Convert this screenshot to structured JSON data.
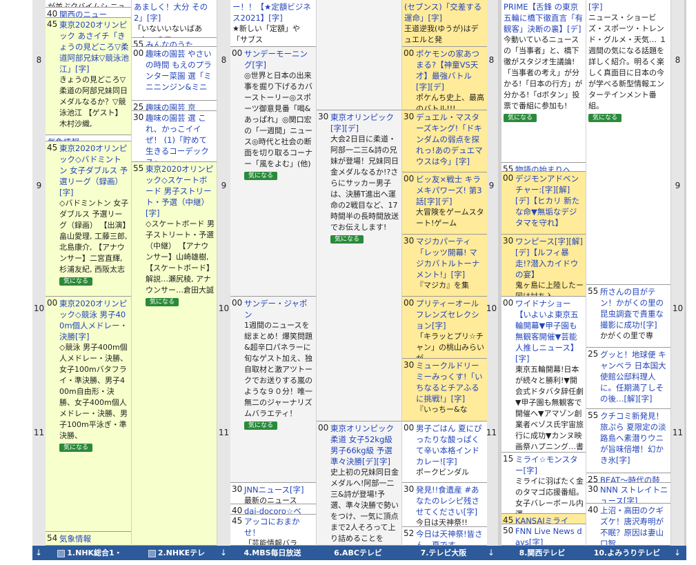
{
  "hours": [
    "8",
    "9",
    "10",
    "11"
  ],
  "badge_label": "気になる",
  "footer": {
    "arrow": "↓",
    "channels": [
      "1.NHK総合1・",
      "2.NHKEテレ",
      "4.MBS毎日放送",
      "6.ABCテレビ",
      "7.テレビ大阪",
      "8.関西テレビ",
      "10.よみうりテレビ"
    ]
  },
  "columns": [
    {
      "channel": "1.NHK総合1・",
      "cells": [
        {
          "min": "",
          "title": "",
          "desc": "が並ぶクバイムシ ニュースは…",
          "color": "white",
          "badge": false
        },
        {
          "min": "40",
          "title": "関西のニュー",
          "desc": "",
          "color": "white",
          "badge": false
        },
        {
          "min": "45",
          "title": "東京2020オリンピック あさイチ「きょうの見どころ▽柔道阿部兄妹▽競泳池江」[字]",
          "desc": "きょうの見どころ▽柔道の阿部兄妹同日メダルなるか？▽競泳池江 【ゲスト】木村沙織,",
          "color": "green",
          "badge": false
        },
        {
          "min": "",
          "title": "気象情報",
          "desc": "",
          "color": "white",
          "badge": false
        },
        {
          "min": "45",
          "title": "東京2020オリンピック◇バドミントン 女子ダブルス 予選リーグ（録画）[字]",
          "desc": "◇バドミントン 女子ダブルス 予選リーグ（録画） 【出演】畠山愛理, 工藤三郎, 北島康介, 【アナウンサー】二宮直輝, 杉浦友紀, 西阪太志",
          "color": "green",
          "badge": true
        },
        {
          "min": "00",
          "title": "東京2020オリンピック◇競泳 男子400m個人メドレー・決勝[字]",
          "desc": "◇競泳 男子400m個人メドレー・決勝、女子100mバタフライ・準決勝、男子400m自由形・決勝、女子400m個人メドレー・決勝、男子100m平泳ぎ・準決勝、",
          "color": "green",
          "badge": true
        },
        {
          "min": "54",
          "title": "気象情報",
          "desc": "",
          "color": "green",
          "badge": false
        }
      ]
    },
    {
      "channel": "2.NHKEテレ",
      "cells": [
        {
          "min": "",
          "title": "あましく！大分 その2」[字]",
          "desc": "「いないいないばあっ！」のワ",
          "color": "white",
          "badge": false
        },
        {
          "min": "55",
          "title": "みんなのうた",
          "desc": "",
          "color": "white",
          "badge": false
        },
        {
          "min": "00",
          "title": "趣味の園芸 やさいの時間 もえのプランター菜園 選「ミニニンジン&ミニ",
          "desc": "",
          "color": "white",
          "badge": false
        },
        {
          "min": "25",
          "title": "趣味の園芸 京",
          "desc": "",
          "color": "white",
          "badge": false
        },
        {
          "min": "30",
          "title": "趣味の園芸 選 これ、かっこイイぜ！ (1)「貯めて生きるコーデックス」",
          "desc": "",
          "color": "white",
          "badge": false
        },
        {
          "min": "55",
          "title": "東京2020オリンピック◇スケートボード 男子ストリート・予選（中継）[字]",
          "desc": "◇スケートボード 男子ストリート・予選（中継） 【アナウンサー】山崎雄樹, 【スケートボード】解説…瀬尻稜, アナウンサー…倉田大誠",
          "color": "green",
          "badge": true
        }
      ]
    },
    {
      "channel": "4.MBS毎日放送",
      "cells": [
        {
          "min": "",
          "title": "ー！！【★定額ビジネス2021】[字]",
          "desc": "★新しい「定額」や「サブス",
          "color": "white",
          "badge": false
        },
        {
          "min": "00",
          "title": "サンデーモーニング[字]",
          "desc": "◎世界と日本の出来事を掘り下げるカバーストーリー◎スポーツ御意見番「喝&あっぱれ」◎関口宏の「一週間」ニュース◎時代と社会の断面を切り取るコーナー「風をよむ」(他)",
          "color": "gray",
          "badge": true
        },
        {
          "min": "00",
          "title": "サンデー・ジャポン",
          "desc": "1週間のニュースを総まとめ！爆笑問題&超辛口パネラーに旬なゲスト加え、独自取材と激アツトークでお送りする嵐のような９０分！唯一無二のジャーナリズムバラエティ！",
          "color": "gray",
          "badge": true
        },
        {
          "min": "30",
          "title": "JNNニュース[字]",
          "desc": "最新のニュース",
          "color": "white",
          "badge": false
        },
        {
          "min": "40",
          "title": "dai-docoro☆ベ",
          "desc": "",
          "color": "white",
          "badge": false
        },
        {
          "min": "45",
          "title": "アッコにおまかせ！",
          "desc": "「芸能情報バラ",
          "color": "white",
          "badge": false
        }
      ]
    },
    {
      "channel": "6.ABCテレビ",
      "cells": [
        {
          "min": "",
          "title": "",
          "desc": "",
          "color": "gray",
          "badge": false
        },
        {
          "min": "30",
          "title": "東京オリンピック[字][デ]",
          "desc": "大会2日目に柔道・阿部一二三&詩の兄妹が登場！兄妹同日金メダルなるか!?さらにサッカー男子は、決勝T進出へ運命の2戦目など、17時間半の長時間放送でお伝えします!",
          "color": "gray",
          "badge": true
        },
        {
          "min": "00",
          "title": "東京オリンピック 柔道 女子52kg級 男子66kg級 予選準々決勝[デ][字]",
          "desc": "史上初の兄妹同日金メダルへ!阿部一二三&詩が登場!予選、準々決勝で勢いをつけ、一気に頂点まで2人そろって上り詰めることを",
          "color": "gray",
          "badge": false
        }
      ]
    },
    {
      "channel": "7.テレビ大阪",
      "cells": [
        {
          "min": "",
          "title": "(セブンス)「交差する運命」[字]",
          "desc": "王道逆我(ゆうが)はデュエルと発",
          "color": "yellow",
          "badge": false
        },
        {
          "min": "00",
          "title": "ポケモンの家あつまる?【神童VS天才】最強バトル[字][デ]",
          "desc": "ポケんち史上、最高のバトル!!!",
          "color": "yellow",
          "badge": false
        },
        {
          "min": "30",
          "title": "デュエル・マスターズキング!「ドキンダムの弱点を探れっ!あのデュエマウスは今」[字]",
          "desc": "",
          "color": "yellow",
          "badge": false
        },
        {
          "min": "00",
          "title": "ビッ友×戦士 キラメキパワーズ! 第3話[字][デ]",
          "desc": "大冒険をゲームスタート!ゲーム",
          "color": "yellow",
          "badge": false
        },
        {
          "min": "30",
          "title": "マジカパーティ「レッツ開幕! マジカバトルトーナメント!」[字]",
          "desc": "『マジカ』を集",
          "color": "yellow",
          "badge": false
        },
        {
          "min": "00",
          "title": "プリティーオールフレンズセレクション[字]",
          "desc": "「キラッとプリ☆チャン」の桃山みらいが,",
          "color": "yellow",
          "badge": false
        },
        {
          "min": "30",
          "title": "ミュークルドリーミーみっくす!「いちなるとチアふるに挑戦!」[字]",
          "desc": "『いっちー&な",
          "color": "yellow",
          "badge": false
        },
        {
          "min": "00",
          "title": "男子ごはん 夏にぴったりな酸っぱくて辛い本格インドカレー![字]",
          "desc": "ポークビンダル",
          "color": "white",
          "badge": false
        },
        {
          "min": "30",
          "title": "発見!!食遺産 #あなたのレシピ残させてください[字]",
          "desc": "今日は天神祭!!",
          "color": "white",
          "badge": false
        },
        {
          "min": "52",
          "title": "今日は天神祭!皆さん、夏です",
          "desc": "",
          "color": "white",
          "badge": false
        }
      ]
    },
    {
      "channel": "8.関西テレビ",
      "cells": [
        {
          "min": "",
          "title": "PRIME【舌鋒 の東京五輪に橋下徹直言「有観客」決断の裏】[デ]",
          "desc": "今動いているニュースの「当事者」と、橋下徹がスタジオ生議論!「当事者の考え」が分かる!「日本の行方」が分かる!「dボタン」投票で番組に参加も!",
          "color": "white",
          "badge": true
        },
        {
          "min": "55",
          "title": "物語の始まりへ",
          "desc": "",
          "color": "white",
          "badge": false
        },
        {
          "min": "00",
          "title": "デジモンアドベンチャー:[字][解][デ]【ヒカリ 新たな命▼無垢なデジタマを守れ】",
          "desc": "",
          "color": "yellow",
          "badge": false
        },
        {
          "min": "30",
          "title": "ワンピース[字][解][デ]【ルフィ暴走!?潜入カイドウの宴】",
          "desc": "鬼ヶ島に上陸したー同は討ち入",
          "color": "yellow",
          "badge": false
        },
        {
          "min": "00",
          "title": "ワイドナショー【いよいよ東京五輪開幕▼甲子園も無観客開催▼芸能人推しニュース】[字]",
          "desc": "東京五輪開幕!日本が続々と勝利!▼開会式ドタバタ辞任劇▼甲子園も無観客で開催へ▼アマゾン創業者ベゾス氏宇宙旅行に成功▼カンヌ映画祭ハプニング…書",
          "color": "white",
          "badge": false
        },
        {
          "min": "15",
          "title": "ミライ☆モンスター[字]",
          "desc": "ミライに羽ばたく金のタマゴ応援番組。女子バレーボール内澤",
          "color": "white",
          "badge": false
        },
        {
          "min": "45",
          "title": "KANSAIミライ",
          "desc": "",
          "color": "yellow",
          "badge": false
        },
        {
          "min": "50",
          "title": "FNN Live News days[字]",
          "desc": "",
          "color": "white",
          "badge": false
        }
      ]
    },
    {
      "channel": "10.よみうりテレビ",
      "cells": [
        {
          "min": "",
          "title": "[字]",
          "desc": "ニュース・ショービズ・スポーツ・トレンド・グルメ・天気… １週間の気になる話題を詳しく紹介。明るく楽しく真面目に日本の今が学べる新型情報エンターテインメント番組。",
          "color": "white",
          "badge": true
        },
        {
          "min": "55",
          "title": "所さんの目がテン！かがくの里の昆虫調査で貴重な撮影に成功![字]",
          "desc": "かがくの里で専",
          "color": "white",
          "badge": false
        },
        {
          "min": "25",
          "title": "グッと！地球便 キャンベラ 日本国大使館公邸料理人に。任期満了しその後…[解][字]",
          "desc": "",
          "color": "white",
          "badge": false
        },
        {
          "min": "55",
          "title": "クチコミ新発見！旅ぷら 夏限定の淡路島へ素潜りウニが旨味倍増！幻かき氷[字]",
          "desc": "",
          "color": "white",
          "badge": false
        },
        {
          "min": "25",
          "title": "BEAT～時代の鼓",
          "desc": "",
          "color": "white",
          "badge": false
        },
        {
          "min": "30",
          "title": "NNN ストレイトニュース[字]",
          "desc": "",
          "color": "white",
          "badge": false
        },
        {
          "min": "40",
          "title": "上沼・高田のクギズケ！唐沢寿明が不眠？原因は妻山口智",
          "desc": "",
          "color": "white",
          "badge": false
        }
      ]
    }
  ]
}
